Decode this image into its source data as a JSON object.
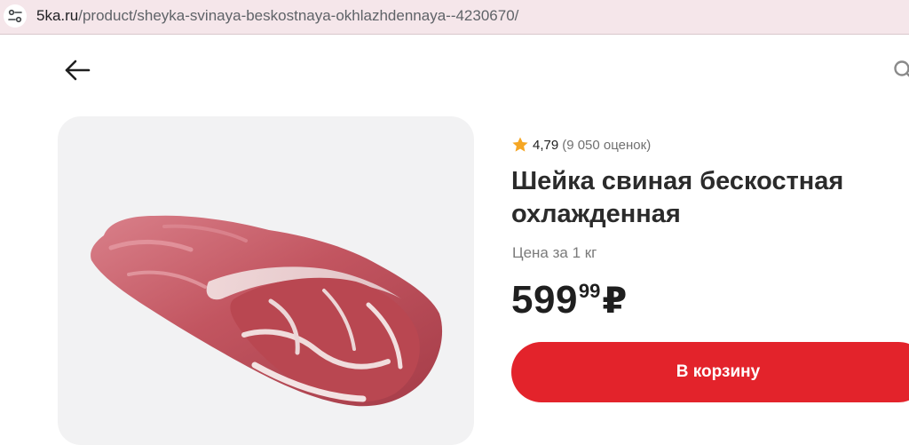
{
  "browser": {
    "url_domain": "5ka.ru",
    "url_path": "/product/sheyka-svinaya-beskostnaya-okhlazhdennaya--4230670/"
  },
  "product": {
    "rating_score": "4,79",
    "rating_count": "(9 050 оценок)",
    "title": "Шейка свиная бескостная охлажденная",
    "unit_label": "Цена за 1 кг",
    "price_rub": "599",
    "price_kop": "99",
    "currency": "₽",
    "add_to_cart_label": "В корзину"
  },
  "icons": {
    "site_info": "site-settings-icon",
    "back": "arrow-left-icon",
    "search": "search-icon",
    "rating": "star-icon"
  },
  "colors": {
    "accent": "#e3232b",
    "star": "#f5a623",
    "image_bg": "#f2f2f3",
    "urlbar_bg": "#f5e6ea"
  }
}
